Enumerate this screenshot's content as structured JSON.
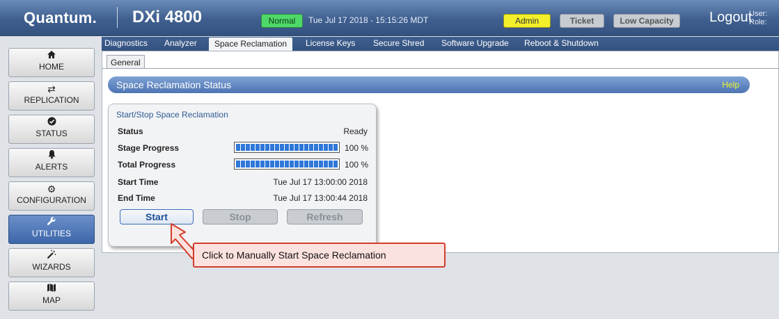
{
  "header": {
    "brand": "Quantum.",
    "product": "DXi 4800",
    "status_badge": "Normal",
    "datetime": "Tue Jul 17 2018 - 15:15:26 MDT",
    "admin_badge": "Admin",
    "ticket_badge": "Ticket",
    "capacity_badge": "Low Capacity",
    "logout": "Logout",
    "user_label": "User:",
    "role_label": "Role:"
  },
  "sidebar": {
    "items": [
      {
        "label": "HOME",
        "icon": "home-icon"
      },
      {
        "label": "REPLICATION",
        "icon": "replication-icon"
      },
      {
        "label": "STATUS",
        "icon": "status-icon"
      },
      {
        "label": "ALERTS",
        "icon": "bell-icon"
      },
      {
        "label": "CONFIGURATION",
        "icon": "gear-icon"
      },
      {
        "label": "UTILITIES",
        "icon": "wrench-icon"
      },
      {
        "label": "WIZARDS",
        "icon": "wand-icon"
      },
      {
        "label": "MAP",
        "icon": "map-icon"
      }
    ],
    "active": "UTILITIES"
  },
  "tabs": [
    "Diagnostics",
    "Analyzer",
    "Space Reclamation",
    "License Keys",
    "Secure Shred",
    "Software Upgrade",
    "Reboot & Shutdown"
  ],
  "active_tab": "Space Reclamation",
  "subtab": "General",
  "section": {
    "title": "Space Reclamation Status",
    "help": "Help"
  },
  "panel": {
    "title": "Start/Stop Space Reclamation",
    "status_label": "Status",
    "status_value": "Ready",
    "stage_label": "Stage Progress",
    "stage_pct": "100 %",
    "stage_value": 100,
    "total_label": "Total Progress",
    "total_pct": "100 %",
    "total_value": 100,
    "start_label": "Start Time",
    "start_value": "Tue Jul 17 13:00:00 2018",
    "end_label": "End Time",
    "end_value": "Tue Jul 17 13:00:44 2018",
    "buttons": {
      "start": "Start",
      "stop": "Stop",
      "refresh": "Refresh"
    }
  },
  "callout": "Click to Manually Start Space Reclamation",
  "colors": {
    "accent": "#3d67aa",
    "callout_border": "#d23d2b",
    "normal": "#4fd86a",
    "admin": "#f3ef2a"
  }
}
